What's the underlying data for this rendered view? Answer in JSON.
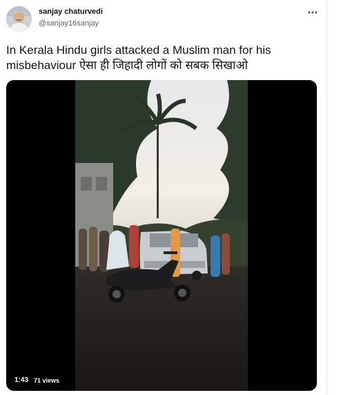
{
  "tweet": {
    "author": {
      "display_name": "sanjay chaturvedi",
      "handle": "@sanjay16sanjay",
      "avatar_icon": "profile-photo"
    },
    "more_icon": "more-horizontal-icon",
    "text": "In Kerala Hindu girls attacked a Muslim man for his misbehaviour ऐसा ही जिहादी लोगों को सबक सिखाओ",
    "media": {
      "type": "video",
      "duration": "1:43",
      "views": "71 views"
    }
  },
  "colors": {
    "text_primary": "#0f1419",
    "text_secondary": "#536471",
    "media_background": "#000000"
  }
}
